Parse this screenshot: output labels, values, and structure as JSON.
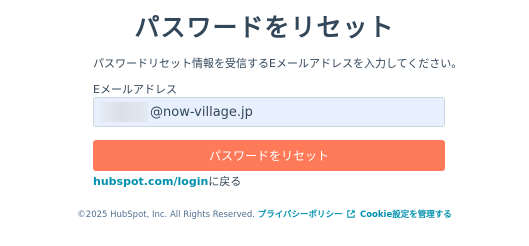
{
  "page": {
    "title": "パスワードをリセット",
    "instructions": "パスワードリセット情報を受信するEメールアドレスを入力してください。"
  },
  "form": {
    "email_label": "Eメールアドレス",
    "email_value_visible": "@now-village.jp",
    "submit_label": "パスワードをリセット"
  },
  "back": {
    "link_text": "hubspot.com/login",
    "suffix": "に戻る"
  },
  "footer": {
    "copyright": "©2025 HubSpot, Inc. All Rights Reserved.",
    "privacy_label": "プライバシーポリシー",
    "cookie_label": "Cookie設定を管理する",
    "external_icon": "external-link-icon"
  },
  "colors": {
    "accent": "#ff7a59",
    "link": "#0091ae",
    "text": "#33475b",
    "input_bg": "#e8f0fe"
  }
}
